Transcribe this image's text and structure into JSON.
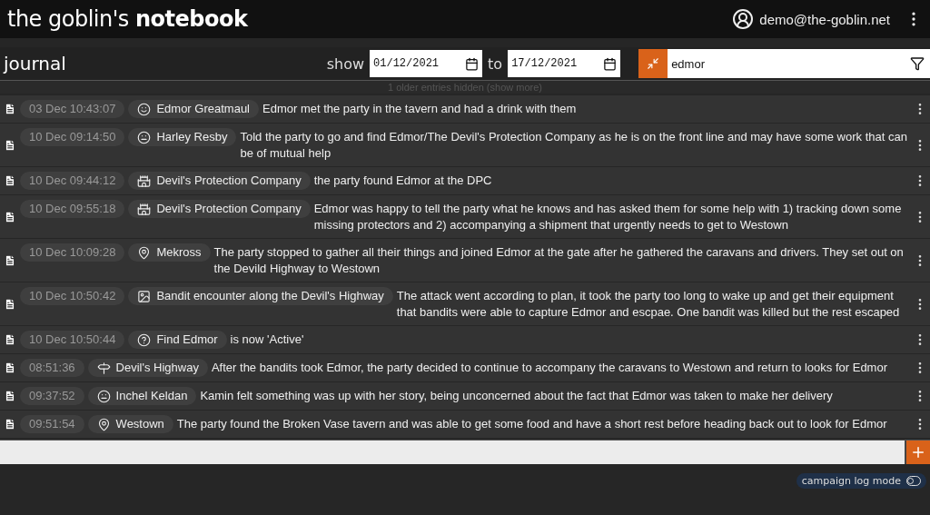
{
  "app": {
    "title_light": "the goblin's",
    "title_bold": "notebook",
    "user": "demo@the-goblin.net"
  },
  "toolbar": {
    "title": "journal",
    "show_label": "show",
    "from": "01/12/2021",
    "to_label": "to",
    "to": "17/12/2021",
    "search": "edmor"
  },
  "hidden_notice": "1 older entries hidden (show more)",
  "entries": [
    {
      "time": "03 Dec 10:43:07",
      "tag": "Edmor Greatmaul",
      "kind": "happy",
      "text": "Edmor met the party in the tavern and had a drink with them"
    },
    {
      "time": "10 Dec 09:14:50",
      "tag": "Harley Resby",
      "kind": "neutral",
      "text": "Told the party to go and find Edmor/The Devil's Protection Company as he is on the front line and may have some work that can be of mutual help"
    },
    {
      "time": "10 Dec 09:44:12",
      "tag": "Devil's Protection Company",
      "kind": "faction",
      "text": "the party found Edmor at the DPC"
    },
    {
      "time": "10 Dec 09:55:18",
      "tag": "Devil's Protection Company",
      "kind": "faction",
      "text": "Edmor was happy to tell the party what he knows and has asked them for some help with 1) tracking down some missing protectors and 2) accompanying a shipment that urgently needs to get to Westown"
    },
    {
      "time": "10 Dec 10:09:28",
      "tag": "Mekross",
      "kind": "location",
      "text": "The party stopped to gather all their things and joined Edmor at the gate after he gathered the caravans and drivers. They set out on the Devild Highway to Westown"
    },
    {
      "time": "10 Dec 10:50:42",
      "tag": "Bandit encounter along the Devil's Highway",
      "kind": "scene",
      "text": "The attack went according to plan, it took the party too long to wake up and get their equipment that bandits were able to capture Edmor and escpae. One bandit was killed but the rest escaped"
    },
    {
      "time": "10 Dec 10:50:44",
      "tag": "Find Edmor",
      "kind": "quest",
      "text": "is now 'Active'"
    },
    {
      "time": "08:51:36",
      "tag": "Devil's Highway",
      "kind": "road",
      "text": "After the bandits took Edmor, the party decided to continue to accompany the caravans to Westown and return to looks for Edmor"
    },
    {
      "time": "09:37:52",
      "tag": "Inchel Keldan",
      "kind": "neutral",
      "text": "Kamin felt something was up with her story, being unconcerned about the fact that Edmor was taken to make her delivery"
    },
    {
      "time": "09:51:54",
      "tag": "Westown",
      "kind": "location",
      "text": "The party found the Broken Vase tavern and was able to get some food and have a short rest before heading back out to look for Edmor"
    }
  ],
  "footer": {
    "mode_label": "campaign log mode",
    "on": false
  }
}
